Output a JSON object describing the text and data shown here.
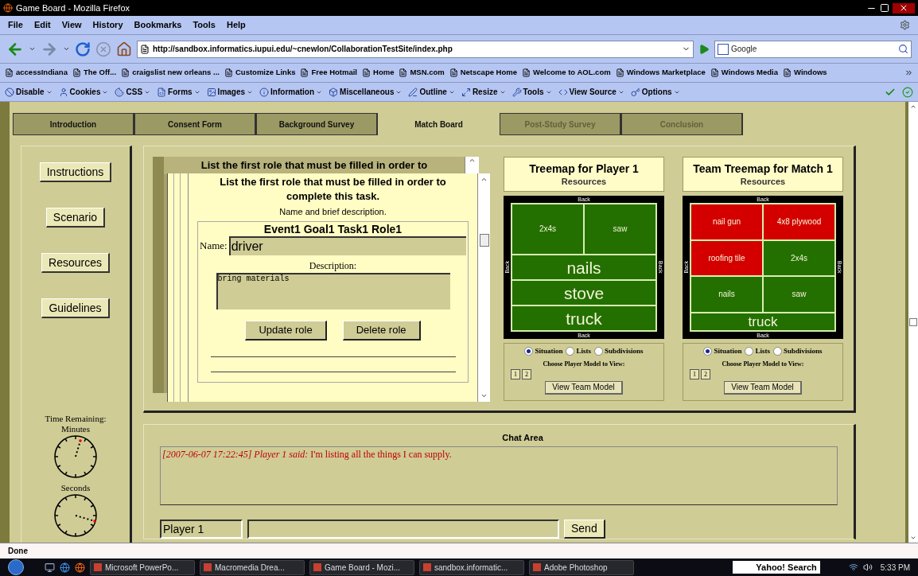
{
  "window": {
    "title": "Game Board - Mozilla Firefox"
  },
  "menu": [
    "File",
    "Edit",
    "View",
    "History",
    "Bookmarks",
    "Tools",
    "Help"
  ],
  "address": "http://sandbox.informatics.iupui.edu/~cnewlon/CollaborationTestSite/index.php",
  "search": {
    "placeholder": "Google"
  },
  "bookmarks": [
    "accessIndiana",
    "The Off...",
    "craigslist new orleans ...",
    "Customize Links",
    "Free Hotmail",
    "Home",
    "MSN.com",
    "Netscape Home",
    "Welcome to AOL.com",
    "Windows Marketplace",
    "Windows Media",
    "Windows"
  ],
  "dev_toolbar": [
    "Disable",
    "Cookies",
    "CSS",
    "Forms",
    "Images",
    "Information",
    "Miscellaneous",
    "Outline",
    "Resize",
    "Tools",
    "View Source",
    "Options"
  ],
  "tabs": [
    {
      "label": "Introduction",
      "selected": false,
      "disabled": false
    },
    {
      "label": "Consent Form",
      "selected": false,
      "disabled": false
    },
    {
      "label": "Background Survey",
      "selected": false,
      "disabled": false
    },
    {
      "label": "Match Board",
      "selected": true,
      "disabled": false
    },
    {
      "label": "Post-Study Survey",
      "selected": false,
      "disabled": true
    },
    {
      "label": "Conclusion",
      "selected": false,
      "disabled": true
    }
  ],
  "side_buttons": [
    "Instructions",
    "Scenario",
    "Resources",
    "Guidelines"
  ],
  "timer": {
    "title": "Time Remaining:",
    "minutes_label": "Minutes",
    "seconds_label": "Seconds"
  },
  "role_panel": {
    "back_heading": "List the first role that must be filled in order to",
    "heading": "List the first role that must be filled in order to complete this task.",
    "subheading": "Name and brief description.",
    "role_title": "Event1 Goal1 Task1 Role1",
    "name_label": "Name:",
    "name_value": "driver",
    "description_label": "Description:",
    "description_value": "bring materials",
    "buttons": [
      "Update role",
      "Delete role"
    ]
  },
  "treemaps": [
    {
      "title": "Treemap for Player 1",
      "subtitle": "Resources",
      "edges": [
        "Back",
        "Back",
        "Back",
        "Back"
      ],
      "rows": [
        {
          "cells": [
            {
              "label": "2x4s",
              "color": "#237000",
              "kind": "small"
            },
            {
              "label": "saw",
              "color": "#237000",
              "kind": "small"
            }
          ]
        },
        {
          "cells": [
            {
              "label": "nails",
              "color": "#237000",
              "kind": "large"
            }
          ]
        },
        {
          "cells": [
            {
              "label": "stove",
              "color": "#237000",
              "kind": "large"
            }
          ]
        },
        {
          "cells": [
            {
              "label": "truck",
              "color": "#237000",
              "kind": "large"
            }
          ]
        }
      ],
      "views": [
        {
          "label": "Situation",
          "selected": true
        },
        {
          "label": "Lists",
          "selected": false
        },
        {
          "label": "Subdivisions",
          "selected": false
        }
      ],
      "choose_label": "Choose Player Model to View:",
      "models": [
        "1",
        "2"
      ],
      "team_button": "View Team Model"
    },
    {
      "title": "Team Treemap for Match 1",
      "subtitle": "Resources",
      "edges": [
        "Back",
        "Back",
        "Back",
        "Back"
      ],
      "rows": [
        {
          "cells": [
            {
              "label": "nail gun",
              "color": "#d40000",
              "kind": "small"
            },
            {
              "label": "4x8 plywood",
              "color": "#d40000",
              "kind": "small"
            }
          ]
        },
        {
          "cells": [
            {
              "label": "roofing tile",
              "color": "#d40000",
              "kind": "small"
            },
            {
              "label": "2x4s",
              "color": "#237000",
              "kind": "small"
            }
          ]
        },
        {
          "cells": [
            {
              "label": "nails",
              "color": "#237000",
              "kind": "small"
            },
            {
              "label": "saw",
              "color": "#237000",
              "kind": "small"
            }
          ]
        },
        {
          "cells": [
            {
              "label": "truck",
              "color": "#237000",
              "kind": "medium"
            }
          ]
        }
      ],
      "views": [
        {
          "label": "Situation",
          "selected": true
        },
        {
          "label": "Lists",
          "selected": false
        },
        {
          "label": "Subdivisions",
          "selected": false
        }
      ],
      "choose_label": "Choose Player Model to View:",
      "models": [
        "1",
        "2"
      ],
      "team_button": "View Team Model"
    }
  ],
  "chat": {
    "title": "Chat Area",
    "messages": [
      "*[2007-06-07 17:22:45] Player 1 said:* I'm listing all the things I can supply."
    ],
    "name_value": "Player 1",
    "send": "Send"
  },
  "status_bar": "Done",
  "taskbar": {
    "tasks": [
      "Microsoft PowerPo...",
      "Macromedia Drea...",
      "Game Board - Mozi...",
      "sandbox.informatic...",
      "Adobe Photoshop"
    ],
    "search": "Yahoo! Search",
    "clock": "5:33 PM"
  }
}
